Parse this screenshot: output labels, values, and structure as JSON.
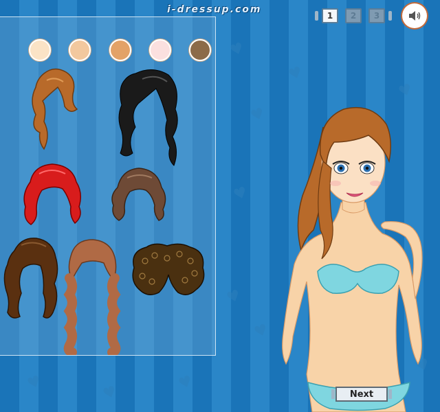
{
  "site": {
    "logo_text": "i-dressup.com"
  },
  "pages": [
    "1",
    "2",
    "3"
  ],
  "active_page": "1",
  "sound": {
    "icon": "speaker-icon"
  },
  "skin_tones": [
    "#fbe3c6",
    "#f2c89e",
    "#e3a267",
    "#fbe0df",
    "#8c6b49"
  ],
  "hairstyles": [
    {
      "name": "auburn-updo-ponytail",
      "color": "#b86a2a"
    },
    {
      "name": "long-black-wavy",
      "color": "#1a1a1a"
    },
    {
      "name": "red-curly-bob",
      "color": "#d81c1c"
    },
    {
      "name": "brown-shag-bob",
      "color": "#6e4a36"
    },
    {
      "name": "dark-brown-wavy-long",
      "color": "#5a3010"
    },
    {
      "name": "light-brown-braids-bangs",
      "color": "#b06a45"
    },
    {
      "name": "dark-curly-afro",
      "color": "#4a3010"
    }
  ],
  "next_button": {
    "label": "Next"
  }
}
